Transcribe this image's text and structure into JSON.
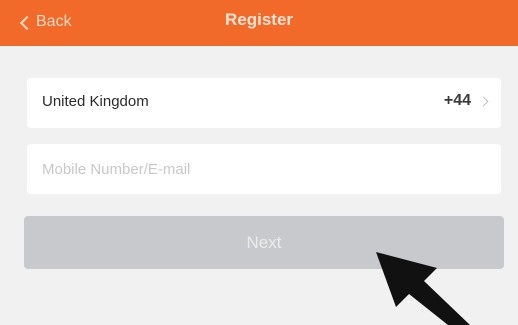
{
  "header": {
    "back_label": "Back",
    "title": "Register",
    "background_color": "#f26a2a"
  },
  "form": {
    "country": {
      "name": "United Kingdom",
      "code": "+44"
    },
    "account_input": {
      "value": "",
      "placeholder": "Mobile Number/E-mail"
    },
    "next_label": "Next",
    "next_button_color": "#c7c9cc"
  },
  "overlay": {
    "icon": "arrow-pointer-icon"
  }
}
